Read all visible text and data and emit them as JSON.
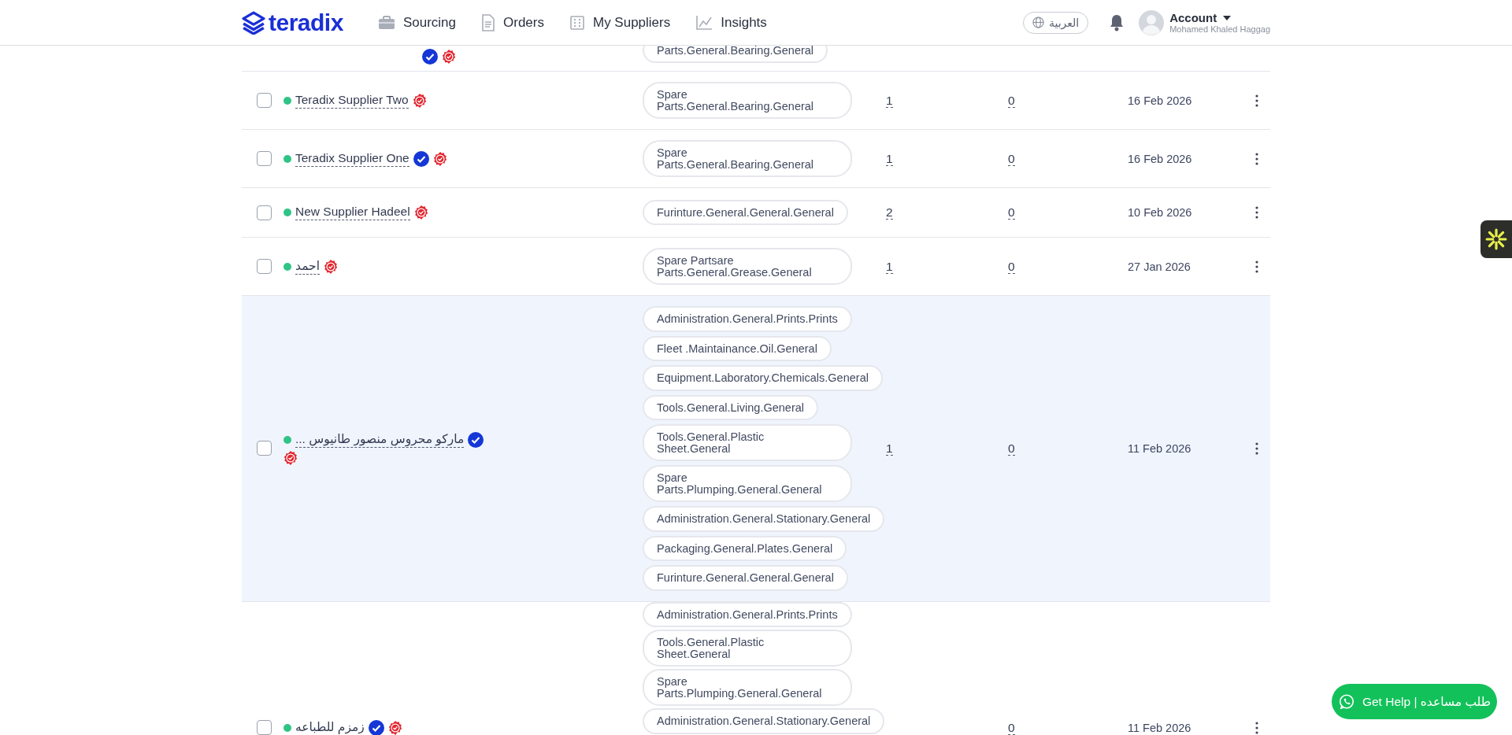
{
  "header": {
    "logo": "teradix",
    "nav": [
      {
        "label": "Sourcing"
      },
      {
        "label": "Orders"
      },
      {
        "label": "My Suppliers"
      },
      {
        "label": "Insights"
      }
    ],
    "language": "العربية",
    "account": {
      "label": "Account",
      "user": "Mohamed Khaled Haggag"
    }
  },
  "rows": [
    {
      "kind": "cut_top",
      "verified": true,
      "highlighted": false,
      "categories": [
        "Parts.General.Bearing.General"
      ]
    },
    {
      "kind": "full",
      "checked": false,
      "name": "Teradix Supplier Two",
      "verified": false,
      "highlighted": false,
      "categories": [
        "Spare Parts.General.Bearing.General"
      ],
      "count_1": "1",
      "count_2": "0",
      "date": "16 Feb 2026"
    },
    {
      "kind": "full",
      "checked": false,
      "name": "Teradix Supplier One",
      "verified": true,
      "highlighted": false,
      "categories": [
        "Spare Parts.General.Bearing.General"
      ],
      "count_1": "1",
      "count_2": "0",
      "date": "16 Feb 2026"
    },
    {
      "kind": "full",
      "checked": false,
      "name": "New Supplier Hadeel",
      "verified": false,
      "highlighted": false,
      "categories": [
        "Furinture.General.General.General"
      ],
      "count_1": "2",
      "count_2": "0",
      "date": "10 Feb 2026"
    },
    {
      "kind": "full",
      "checked": false,
      "name": "احمد",
      "verified": false,
      "highlighted": false,
      "categories": [
        "Spare Partsare Parts.General.Grease.General"
      ],
      "count_1": "1",
      "count_2": "0",
      "date": "27 Jan 2026"
    },
    {
      "kind": "full",
      "checked": false,
      "name": "ماركو محروس منصور طانيوس ...",
      "verified": true,
      "highlighted": true,
      "categories": [
        "Administration.General.Prints.Prints",
        "Fleet .Maintainance.Oil.General",
        "Equipment.Laboratory.Chemicals.General",
        "Tools.General.Living.General",
        "Tools.General.Plastic Sheet.General",
        "Spare Parts.Plumping.General.General",
        "Administration.General.Stationary.General",
        "Packaging.General.Plates.General",
        "Furinture.General.General.General"
      ],
      "count_1": "1",
      "count_2": "0",
      "date": "11 Feb 2026"
    },
    {
      "kind": "cut_bottom",
      "checked": false,
      "name": "زمزم للطباعه",
      "verified": true,
      "highlighted": false,
      "categories": [
        "Administration.General.Prints.Prints",
        "Tools.General.Plastic Sheet.General",
        "Spare Parts.Plumping.General.General",
        "Administration.General.Stationary.General"
      ],
      "count_2": "0",
      "date": "11 Feb 2026"
    }
  ],
  "help_button": "Get Help | طلب مساعده"
}
